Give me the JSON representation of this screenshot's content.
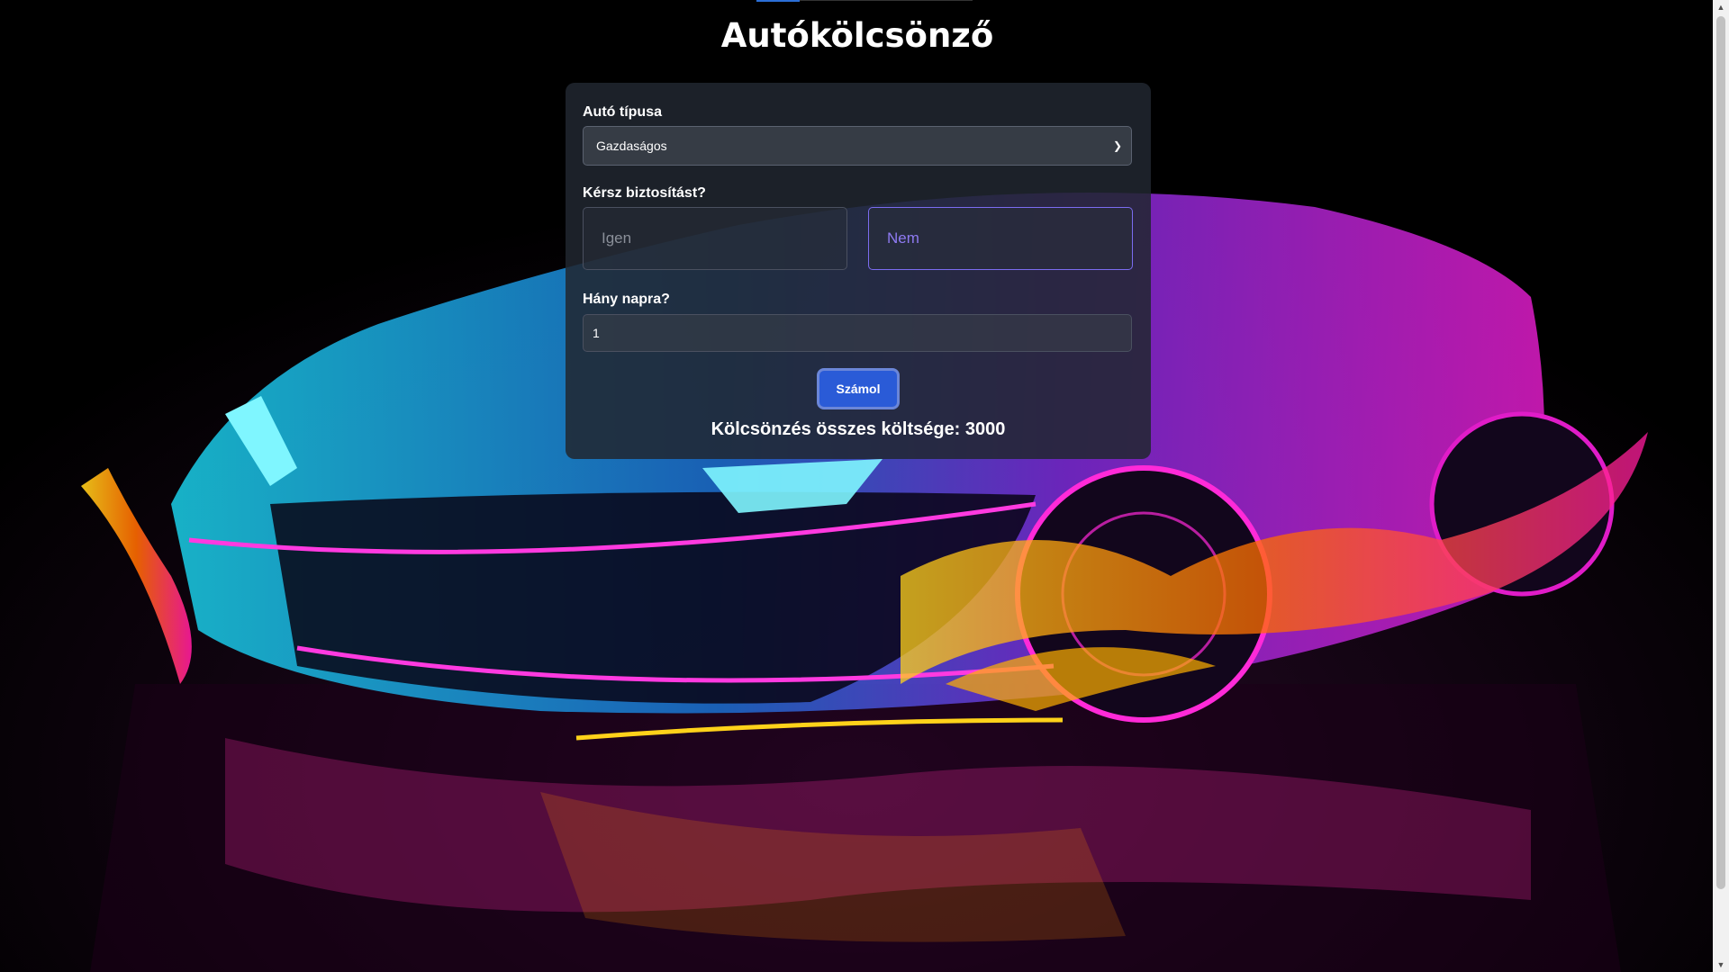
{
  "page": {
    "title": "Autókölcsönző"
  },
  "form": {
    "car_type_label": "Autó típusa",
    "car_type_value": "Gazdaságos",
    "insurance_label": "Kérsz biztosítást?",
    "insurance_yes": "Igen",
    "insurance_no": "Nem",
    "days_label": "Hány napra?",
    "days_value": "1",
    "submit_label": "Számol",
    "result_text": "Kölcsönzés összes költsége: 3000"
  },
  "icons": {
    "select": "chevron-down-icon"
  },
  "colors": {
    "accent": "#2a5bd7",
    "selected_choice": "#7b6cf0"
  }
}
